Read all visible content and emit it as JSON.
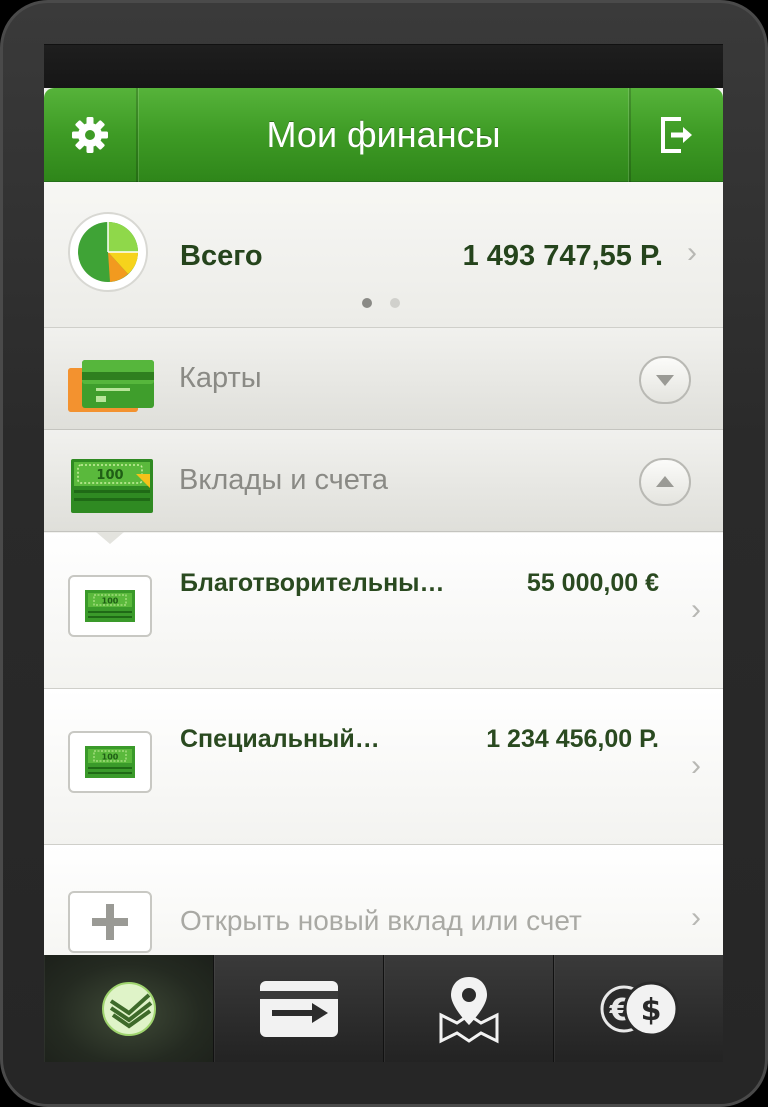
{
  "header": {
    "title": "Мои финансы",
    "settings_icon": "gear-icon",
    "logout_icon": "logout-icon"
  },
  "total": {
    "label": "Всего",
    "value": "1 493 747,55 Р.",
    "page_indicator": {
      "pages": 2,
      "active": 1
    }
  },
  "sections": [
    {
      "label": "Карты",
      "icon": "card-icon",
      "expanded": false
    },
    {
      "label": "Вклады и счета",
      "icon": "banknote-icon",
      "expanded": true
    }
  ],
  "accounts": [
    {
      "name": "Благотворительны…",
      "amount": "55 000,00 €"
    },
    {
      "name": "Специальный…",
      "amount": "1 234 456,00 Р."
    }
  ],
  "open_new": {
    "label": "Открыть новый вклад или счет"
  },
  "tabs": [
    {
      "icon": "sberbank-logo-icon",
      "active": true
    },
    {
      "icon": "transfer-icon",
      "active": false
    },
    {
      "icon": "map-pin-icon",
      "active": false
    },
    {
      "icon": "currency-exchange-icon",
      "active": false
    }
  ],
  "colors": {
    "header_green": "#3e9b25",
    "text_dark_green": "#25441c",
    "pie_green": "#3fa336",
    "pie_light_green": "#8fd84a",
    "pie_orange": "#f29a1f",
    "pie_yellow": "#f6d31c"
  }
}
